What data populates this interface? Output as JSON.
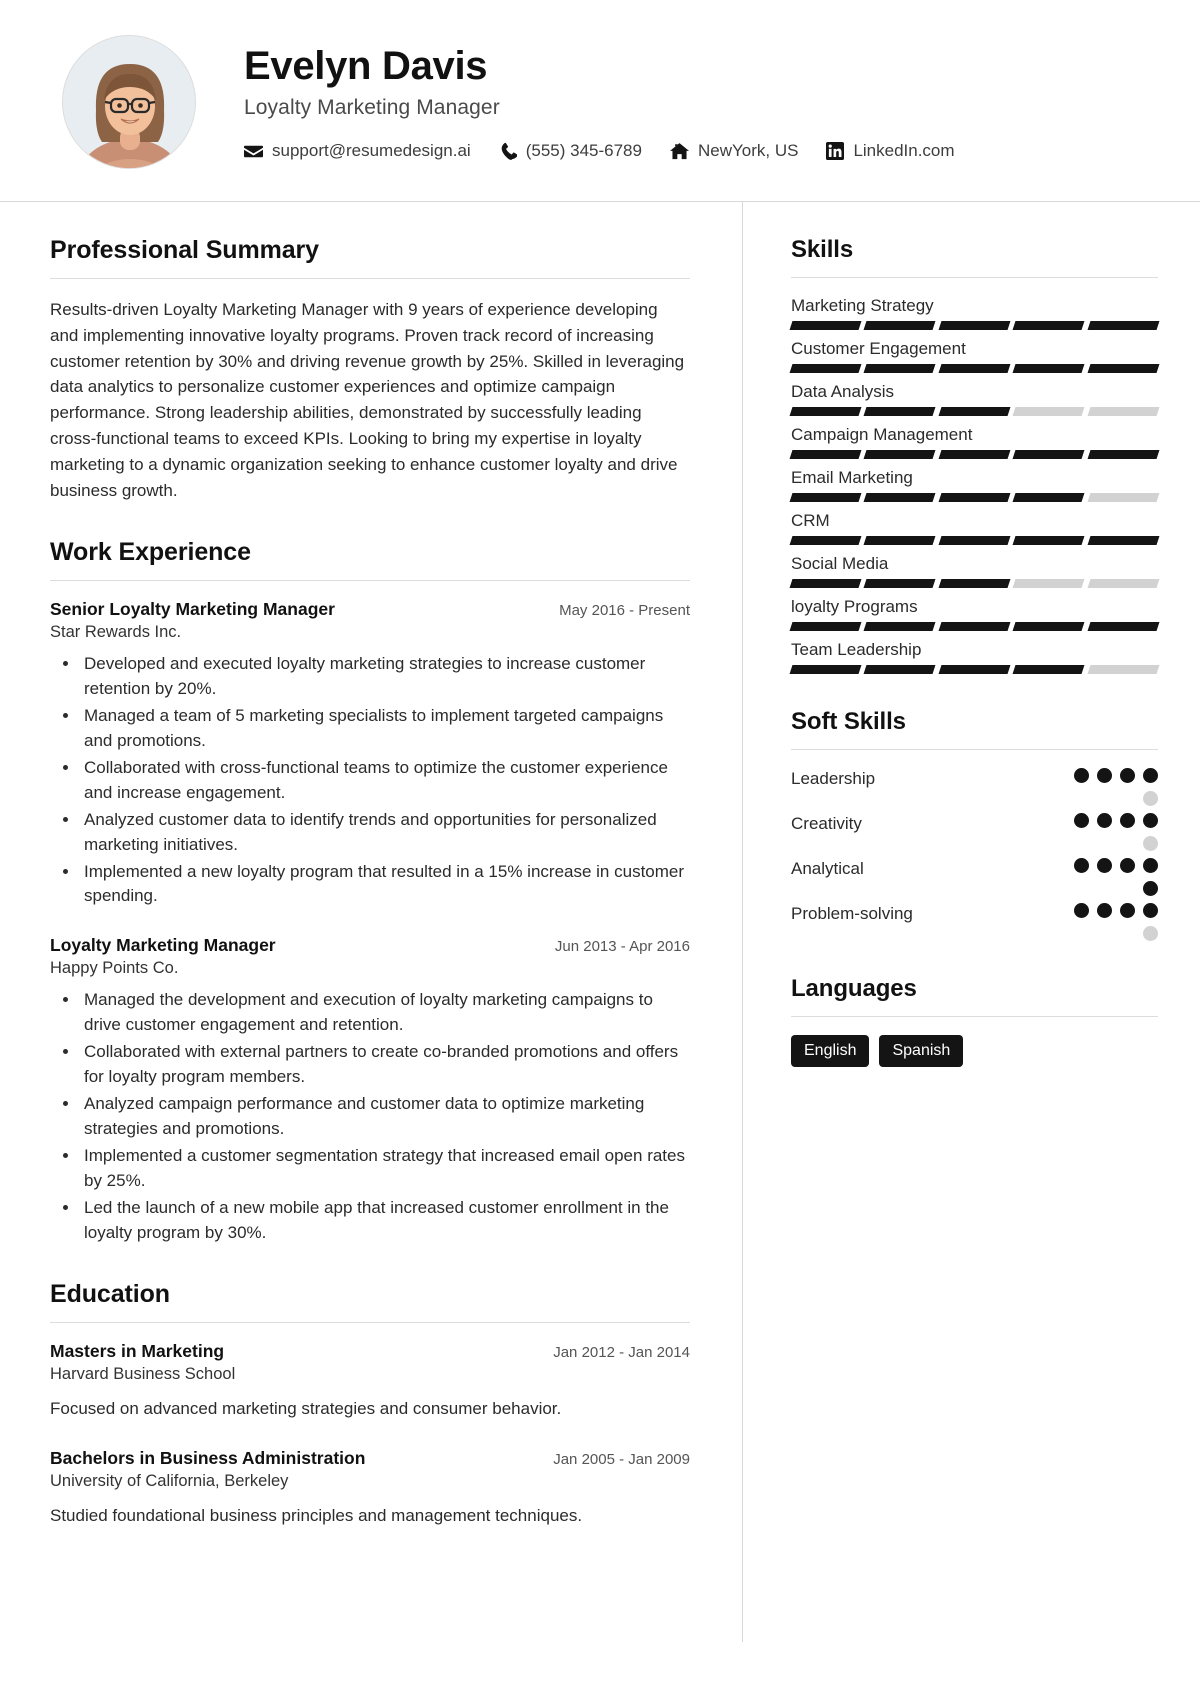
{
  "header": {
    "name": "Evelyn Davis",
    "job_title": "Loyalty Marketing Manager",
    "avatar_alt": "profile-photo",
    "contacts": [
      {
        "icon": "envelope-icon",
        "label": "support@resumedesign.ai"
      },
      {
        "icon": "phone-icon",
        "label": "(555) 345-6789"
      },
      {
        "icon": "home-icon",
        "label": "NewYork, US"
      },
      {
        "icon": "linkedin-icon",
        "label": "LinkedIn.com"
      }
    ]
  },
  "left": {
    "summary": {
      "title": "Professional Summary",
      "text": "Results-driven Loyalty Marketing Manager with 9 years of experience developing and implementing innovative loyalty programs. Proven track record of increasing customer retention by 30% and driving revenue growth by 25%. Skilled in leveraging data analytics to personalize customer experiences and optimize campaign performance. Strong leadership abilities, demonstrated by successfully leading cross-functional teams to exceed KPIs. Looking to bring my expertise in loyalty marketing to a dynamic organization seeking to enhance customer loyalty and drive business growth."
    },
    "experience": {
      "title": "Work Experience",
      "entries": [
        {
          "role": "Senior Loyalty Marketing Manager",
          "date": "May 2016 - Present",
          "org": "Star Rewards Inc.",
          "bullets": [
            "Developed and executed loyalty marketing strategies to increase customer retention by 20%.",
            "Managed a team of 5 marketing specialists to implement targeted campaigns and promotions.",
            "Collaborated with cross-functional teams to optimize the customer experience and increase engagement.",
            "Analyzed customer data to identify trends and opportunities for personalized marketing initiatives.",
            "Implemented a new loyalty program that resulted in a 15% increase in customer spending."
          ]
        },
        {
          "role": "Loyalty Marketing Manager",
          "date": "Jun 2013 - Apr 2016",
          "org": "Happy Points Co.",
          "bullets": [
            "Managed the development and execution of loyalty marketing campaigns to drive customer engagement and retention.",
            "Collaborated with external partners to create co-branded promotions and offers for loyalty program members.",
            "Analyzed campaign performance and customer data to optimize marketing strategies and promotions.",
            "Implemented a customer segmentation strategy that increased email open rates by 25%.",
            "Led the launch of a new mobile app that increased customer enrollment in the loyalty program by 30%."
          ]
        }
      ]
    },
    "education": {
      "title": "Education",
      "entries": [
        {
          "degree": "Masters in Marketing",
          "date": "Jan 2012 - Jan 2014",
          "school": "Harvard Business School",
          "description": "Focused on advanced marketing strategies and consumer behavior."
        },
        {
          "degree": "Bachelors in Business Administration",
          "date": "Jan 2005 - Jan 2009",
          "school": "University of California, Berkeley",
          "description": "Studied foundational business principles and management techniques."
        }
      ]
    }
  },
  "right": {
    "skills": {
      "title": "Skills",
      "max_segments": 5,
      "items": [
        {
          "name": "Marketing Strategy",
          "level": 5
        },
        {
          "name": "Customer Engagement",
          "level": 5
        },
        {
          "name": "Data Analysis",
          "level": 3
        },
        {
          "name": "Campaign Management",
          "level": 5
        },
        {
          "name": "Email Marketing",
          "level": 4
        },
        {
          "name": "CRM",
          "level": 5
        },
        {
          "name": "Social Media",
          "level": 3
        },
        {
          "name": "loyalty Programs",
          "level": 5
        },
        {
          "name": "Team Leadership",
          "level": 4
        }
      ]
    },
    "soft_skills": {
      "title": "Soft Skills",
      "max_dots": 5,
      "items": [
        {
          "name": "Leadership",
          "level": 4
        },
        {
          "name": "Creativity",
          "level": 4
        },
        {
          "name": "Analytical",
          "level": 5
        },
        {
          "name": "Problem-solving",
          "level": 4
        }
      ]
    },
    "languages": {
      "title": "Languages",
      "items": [
        "English",
        "Spanish"
      ]
    }
  },
  "colors": {
    "ink": "#141414",
    "muted": "#d2d2d2",
    "rule": "#dddddd"
  }
}
